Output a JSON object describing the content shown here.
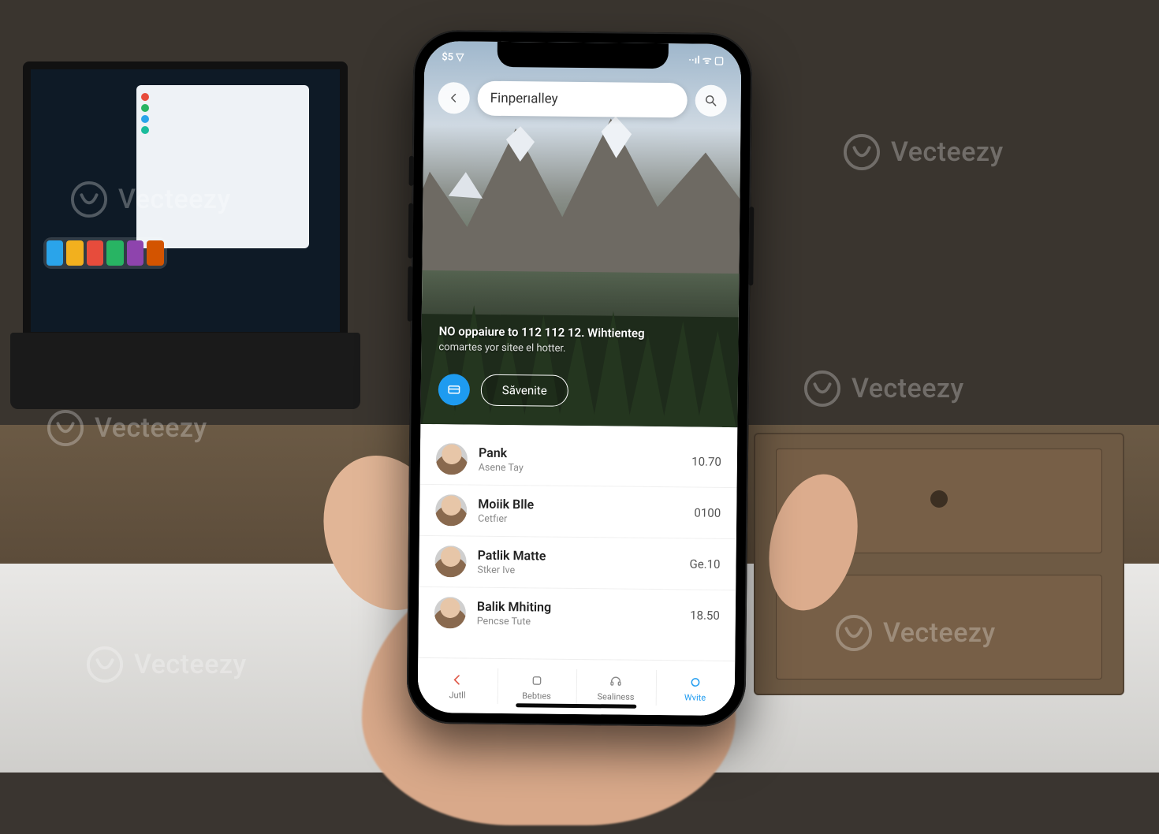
{
  "watermark": {
    "text": "Vecteezy"
  },
  "statusbar": {
    "left": "$5 ▽",
    "right": "··ıl ᯤ ▢"
  },
  "search": {
    "title": "Finperıalley"
  },
  "hero": {
    "line1": "NO oppaiure to 112 112 12.   Wihtienteg",
    "line2": "comartes yor sitee el hotter.",
    "button_label": "Săvenite"
  },
  "list": [
    {
      "name": "Pank",
      "sub": "Asene Tay",
      "value": "10.70"
    },
    {
      "name": "Moiik Blle",
      "sub": "Cetfıer",
      "value": "0100"
    },
    {
      "name": "Patlik Matte",
      "sub": "Stker Ive",
      "value": "Ge.10"
    },
    {
      "name": "Balik Mhiting",
      "sub": "Pencse Tute",
      "value": "18.50"
    }
  ],
  "tabs": [
    {
      "label": "Jutll"
    },
    {
      "label": "Bebtıes"
    },
    {
      "label": "Sealiness"
    },
    {
      "label": "Wvite"
    }
  ],
  "laptop_chips": [
    "",
    "",
    "",
    ""
  ],
  "dock_colors": [
    "#2aa4ea",
    "#f2b01e",
    "#e74c3c",
    "#28b463",
    "#8e44ad",
    "#d35400"
  ]
}
